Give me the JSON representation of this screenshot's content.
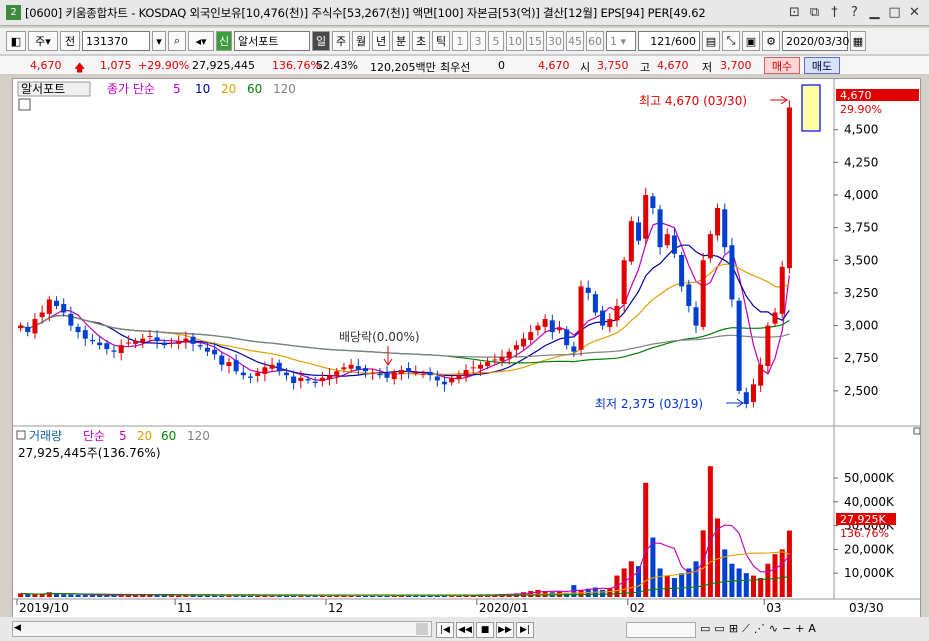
{
  "window": {
    "badge": "2",
    "title": "[0600] 키움종합차트 - KOSDAQ 외국인보유[10,476(천)] 주식수[53,267(천)] 액면[100] 자본금[53(억)] 결산[12월] EPS[94] PER[49.62"
  },
  "toolbar": {
    "type_label": "주",
    "all_label": "전",
    "code": "131370",
    "stock_name": "알서포트",
    "period_tabs": [
      "일",
      "주",
      "월",
      "년",
      "분",
      "초",
      "틱"
    ],
    "intervals": [
      "1",
      "3",
      "5",
      "10",
      "15",
      "30",
      "45",
      "60"
    ],
    "custom_interval": "1",
    "page_count": "121/600",
    "date": "2020/03/30"
  },
  "price_info": {
    "price": "4,670",
    "change": "1,075",
    "change_pct": "+29.90%",
    "volume": "27,925,445",
    "volume_ratio": "136.76%",
    "turnover": "52.43%",
    "amount": "120,205백만",
    "preferred_label": "최우선",
    "preferred_value": "0",
    "preferred_price": "4,670",
    "open_label": "시",
    "open": "3,750",
    "high_label": "고",
    "high": "4,670",
    "low_label": "저",
    "low": "3,700",
    "buy_label": "매수",
    "sell_label": "매도"
  },
  "price_panel": {
    "stock_label": "알서포트",
    "indicator_label": "종가 단순",
    "ma_periods": [
      "5",
      "10",
      "20",
      "60",
      "120"
    ],
    "y_ticks": [
      "4,500",
      "4,250",
      "4,000",
      "3,750",
      "3,500",
      "3,250",
      "3,000",
      "2,750",
      "2,500"
    ],
    "last_price_tag": "4,670",
    "last_pct_tag": "29.90%",
    "high_annotation": "최고 4,670 (03/30)",
    "low_annotation": "최저 2,375 (03/19)",
    "dividend_annotation": "배당락(0.00%)"
  },
  "volume_panel": {
    "label": "거래량",
    "indicator_label": "단순",
    "ma_periods": [
      "5",
      "20",
      "60",
      "120"
    ],
    "current_volume": "27,925,445주(136.76%)",
    "y_ticks": [
      "50,000K",
      "40,000K",
      "30,000K",
      "20,000K",
      "10,000K"
    ],
    "last_volume_tag": "27,925K",
    "last_pct_tag": "136.76%"
  },
  "x_axis": {
    "labels": [
      "2019/10",
      "11",
      "12",
      "2020/01",
      "02",
      "03"
    ],
    "last_date": "03/30"
  },
  "colors": {
    "up": "#e00000",
    "down": "#0040d0",
    "ma5": "#c000c0",
    "ma10": "#0000a0",
    "ma20": "#e0a000",
    "ma60": "#008000",
    "ma120": "#808080"
  },
  "chart_data": {
    "type": "candlestick",
    "price_ylim": [
      2300,
      4750
    ],
    "volume_ylim": [
      0,
      58000
    ],
    "closes": [
      3000,
      2950,
      3050,
      3100,
      3200,
      3150,
      3100,
      3000,
      2950,
      2900,
      2880,
      2850,
      2820,
      2800,
      2850,
      2870,
      2880,
      2900,
      2920,
      2880,
      2850,
      2870,
      2880,
      2900,
      2860,
      2840,
      2800,
      2780,
      2700,
      2720,
      2650,
      2620,
      2600,
      2640,
      2680,
      2700,
      2650,
      2620,
      2560,
      2600,
      2580,
      2560,
      2600,
      2620,
      2650,
      2680,
      2700,
      2660,
      2650,
      2640,
      2620,
      2600,
      2640,
      2660,
      2650,
      2640,
      2630,
      2620,
      2580,
      2550,
      2600,
      2620,
      2660,
      2680,
      2700,
      2720,
      2740,
      2760,
      2800,
      2850,
      2900,
      2950,
      3000,
      3050,
      2950,
      2980,
      2850,
      2800,
      3300,
      3250,
      3100,
      3000,
      3050,
      3150,
      3500,
      3800,
      3650,
      4000,
      3900,
      3600,
      3700,
      3550,
      3300,
      3150,
      3000,
      3500,
      3700,
      3900,
      3600,
      3200,
      2500,
      2400,
      2550,
      2700,
      3000,
      3100,
      3450,
      4670
    ],
    "volumes": [
      1500,
      1200,
      1100,
      1300,
      2000,
      1500,
      1200,
      1000,
      900,
      800,
      800,
      700,
      700,
      800,
      900,
      900,
      800,
      900,
      800,
      700,
      700,
      800,
      700,
      800,
      700,
      700,
      800,
      700,
      800,
      700,
      800,
      700,
      600,
      700,
      600,
      700,
      700,
      600,
      700,
      600,
      700,
      600,
      700,
      700,
      800,
      700,
      700,
      600,
      700,
      700,
      600,
      600,
      700,
      700,
      600,
      700,
      600,
      700,
      700,
      600,
      800,
      900,
      800,
      900,
      1000,
      900,
      1000,
      1200,
      1300,
      1500,
      2000,
      2500,
      3000,
      2500,
      2000,
      2200,
      1800,
      5000,
      3000,
      3500,
      4000,
      3000,
      3800,
      9000,
      12000,
      15000,
      13000,
      48000,
      25000,
      12000,
      9000,
      8000,
      10000,
      12000,
      15000,
      28000,
      55000,
      33000,
      20000,
      14000,
      12000,
      10000,
      9000,
      8000,
      14000,
      18000,
      20000,
      27925
    ]
  }
}
